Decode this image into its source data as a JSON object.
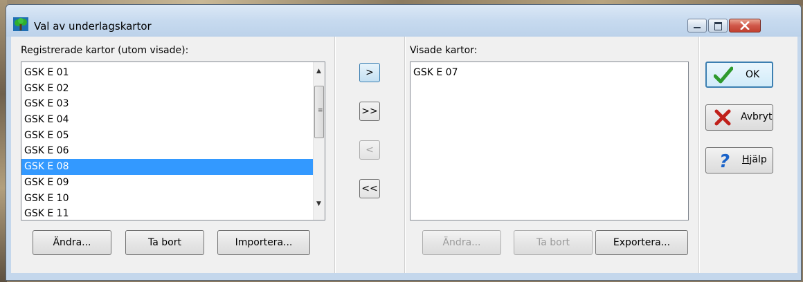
{
  "window": {
    "title": "Val av underlagskartor"
  },
  "left_panel": {
    "label": "Registrerade kartor (utom visade):",
    "items": [
      "GSK E 01",
      "GSK E 02",
      "GSK E 03",
      "GSK E 04",
      "GSK E 05",
      "GSK E 06",
      "GSK E 08",
      "GSK E 09",
      "GSK E 10",
      "GSK E 11"
    ],
    "selected": "GSK E 08",
    "buttons": {
      "edit": "Ändra...",
      "remove": "Ta bort",
      "import": "Importera..."
    }
  },
  "transfer": {
    "add": ">",
    "add_all": ">>",
    "remove": "<",
    "remove_all": "<<"
  },
  "right_panel": {
    "label": "Visade kartor:",
    "items": [
      "GSK E 07"
    ],
    "buttons": {
      "edit": "Ändra...",
      "remove": "Ta bort",
      "export": "Exportera..."
    }
  },
  "actions": {
    "ok": "OK",
    "cancel": "Avbryt",
    "help_prefix": "H",
    "help_rest": "jälp"
  },
  "icons": {
    "app": "tree-icon",
    "ok": "checkmark-icon",
    "cancel": "x-icon",
    "help": "question-icon"
  },
  "colors": {
    "selection": "#3399ff",
    "ok_icon": "#2e9a2e",
    "cancel_icon": "#c0201a",
    "help_icon": "#1a63c9"
  }
}
